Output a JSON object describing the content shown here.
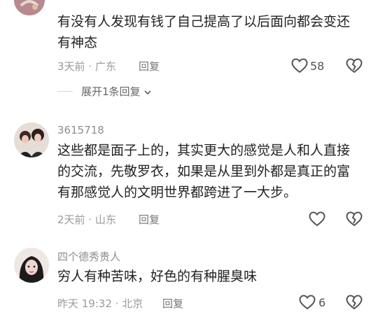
{
  "comments": [
    {
      "text_lines": [
        "有没有人发现有钱了自己提高了以后面向都会变还",
        "有神态"
      ],
      "meta": "3天前 · 广东",
      "reply_label": "回复",
      "like_count": "58",
      "expand_label": "展开1条回复"
    },
    {
      "username": "3615718",
      "text_lines": [
        "这些都是面子上的，其实更大的感觉是人和人直接",
        "的交流，先敬罗衣，如果是从里到外都是真正的富",
        "有那感觉人的文明世界都跨进了一大步。"
      ],
      "meta": "2天前 · 山东",
      "reply_label": "回复",
      "like_count": ""
    },
    {
      "username": "四个德秀贵人",
      "text_lines": [
        "穷人有种苦味，好色的有种腥臭味"
      ],
      "meta": "昨天 19:32 · 北京",
      "reply_label": "回复",
      "like_count": "6"
    }
  ],
  "icons": {
    "like": "heart-outline-icon",
    "dislike": "broken-heart-icon",
    "expand": "chevron-down-icon"
  },
  "colors": {
    "text": "#222222",
    "meta": "#9a9a9a",
    "icon": "#555555"
  }
}
